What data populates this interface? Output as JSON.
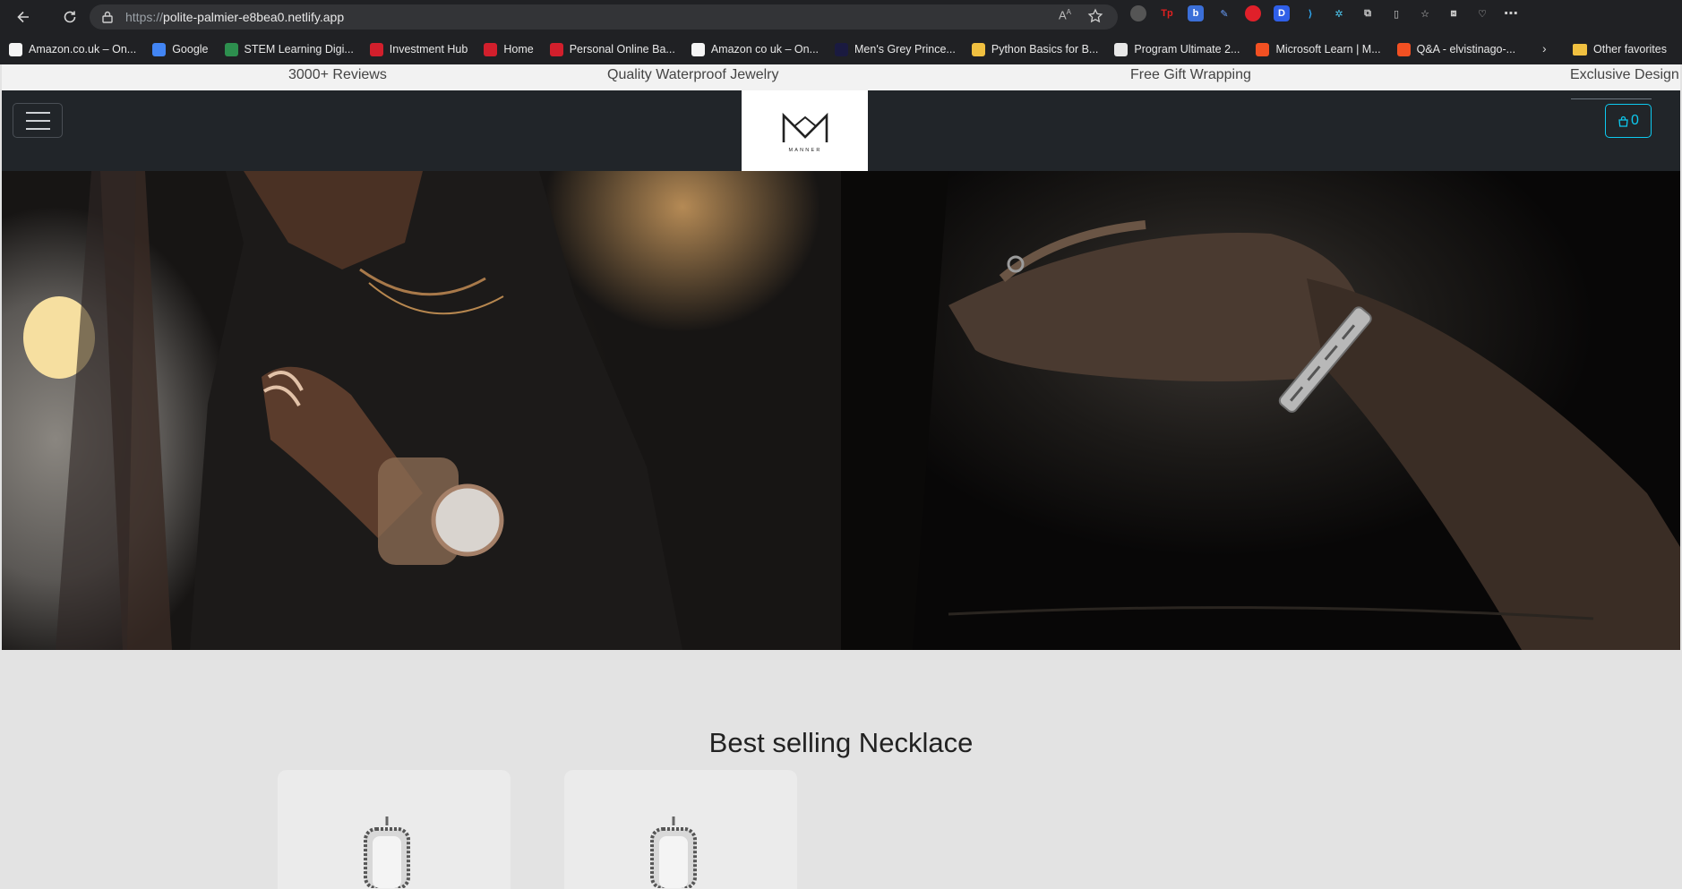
{
  "browser": {
    "url_scheme": "https://",
    "url_host": "polite-palmier-e8bea0.netlify.app",
    "bookmarks": [
      {
        "label": "Amazon.co.uk – On...",
        "color": "#f5f5f5"
      },
      {
        "label": "Google",
        "color": "#4285f4"
      },
      {
        "label": "STEM Learning Digi...",
        "color": "#2d8f4e"
      },
      {
        "label": "Investment Hub",
        "color": "#d21f2c"
      },
      {
        "label": "Home",
        "color": "#d21f2c"
      },
      {
        "label": "Personal Online Ba...",
        "color": "#d21f2c"
      },
      {
        "label": "Amazon co uk – On...",
        "color": "#f5f5f5"
      },
      {
        "label": "Men's Grey Prince...",
        "color": "#1a1a40"
      },
      {
        "label": "Python Basics for B...",
        "color": "#f0c040"
      },
      {
        "label": "Program Ultimate 2...",
        "color": "#e8e8e8"
      },
      {
        "label": "Microsoft Learn | M...",
        "color": "#f25022"
      },
      {
        "label": "Q&A - elvistinago-...",
        "color": "#f25022"
      }
    ],
    "other_favorites": "Other favorites"
  },
  "announcement_bar": {
    "items": [
      "3000+ Reviews",
      "Quality Waterproof Jewelry",
      "Free Gift Wrapping",
      "Exclusive Design"
    ]
  },
  "site_nav": {
    "logo_text": "MANNER",
    "cart_count": "0",
    "accent": "#0dcaf0"
  },
  "hero": {
    "left_image": "man-jewelry-watch-photo",
    "right_image": "man-bracelet-photo"
  },
  "section": {
    "title": "Best selling Necklace",
    "products": [
      {
        "image": "pendant-necklace-icon"
      },
      {
        "image": "pendant-necklace-icon"
      }
    ]
  }
}
